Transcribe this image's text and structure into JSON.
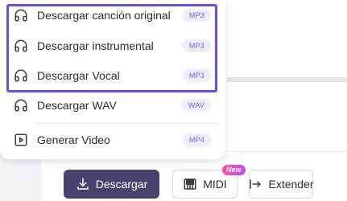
{
  "menu": {
    "items": [
      {
        "label": "Descargar canción original",
        "badge": "MP3",
        "icon": "headphones-icon"
      },
      {
        "label": "Descargar instrumental",
        "badge": "MP3",
        "icon": "headphones-icon"
      },
      {
        "label": "Descargar Vocal",
        "badge": "MP3",
        "icon": "headphones-icon"
      },
      {
        "label": "Descargar WAV",
        "badge": "WAV",
        "icon": "headphones-icon"
      },
      {
        "label": "Generar Video",
        "badge": "MP4",
        "icon": "play-video-icon"
      }
    ]
  },
  "actions": {
    "download_label": "Descargar",
    "midi_label": "MIDI",
    "midi_new_badge": "New",
    "extend_label": "Extender"
  },
  "colors": {
    "highlight": "#6c4ce0",
    "badge_text": "#6a66d8",
    "badge_bg": "#eeedfc",
    "primary_button": "#4a4370",
    "new_badge_from": "#ff4fa3",
    "new_badge_to": "#c04cf2"
  }
}
